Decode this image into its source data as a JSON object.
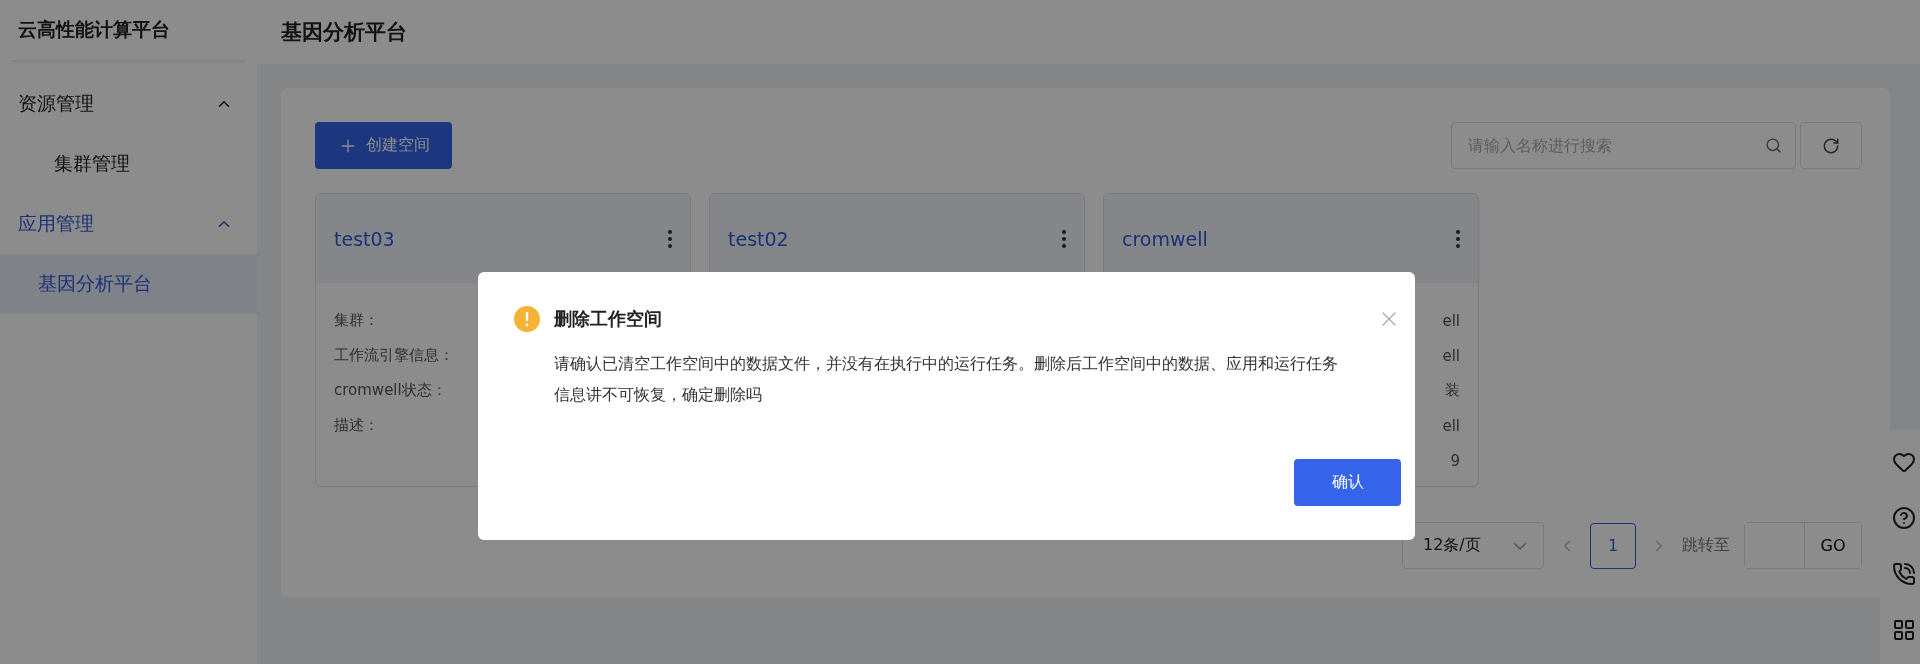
{
  "sidebar": {
    "title": "云高性能计算平台",
    "groups": [
      {
        "label": "资源管理",
        "expanded": true,
        "selected": false,
        "children": [
          {
            "label": "集群管理",
            "selected": false
          }
        ]
      },
      {
        "label": "应用管理",
        "expanded": true,
        "selected": true,
        "children": [
          {
            "label": "基因分析平台",
            "selected": true
          }
        ]
      }
    ]
  },
  "header": {
    "title": "基因分析平台"
  },
  "toolbar": {
    "create_button": "创建空间",
    "search": {
      "placeholder": "请输入名称进行搜索"
    }
  },
  "cards": [
    {
      "name": "test03",
      "rows": [
        {
          "label": "集群："
        },
        {
          "label": "工作流引擎信息："
        },
        {
          "label": "cromwell状态："
        },
        {
          "label": "描述："
        }
      ]
    },
    {
      "name": "test02"
    },
    {
      "name": "cromwell",
      "rows": [
        {
          "value": "ell"
        },
        {
          "value": "ell"
        },
        {
          "value": "装"
        },
        {
          "value": "ell"
        },
        {
          "value": "9"
        }
      ]
    }
  ],
  "pagination": {
    "page_size": "12条/页",
    "pages": [
      {
        "label": "1",
        "selected": true
      }
    ],
    "jump_label": "跳转至",
    "go_button": "GO"
  },
  "dialog": {
    "title": "删除工作空间",
    "message": "请确认已清空工作空间中的数据文件，并没有在执行中的运行任务。删除后工作空间中的数据、应用和运行任务信息讲不可恢复，确定删除吗",
    "confirm_button": "确认"
  }
}
